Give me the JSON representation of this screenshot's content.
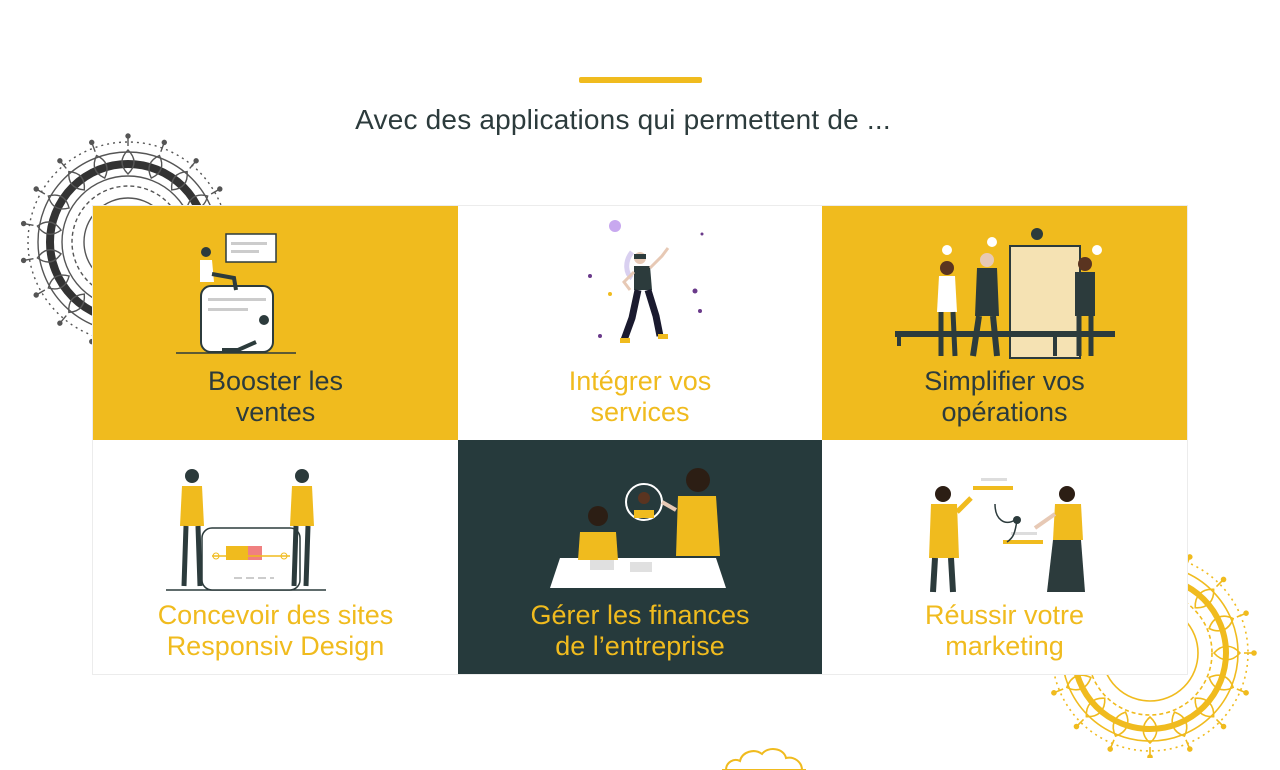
{
  "section": {
    "title": "Avec des applications qui permettent de ..."
  },
  "colors": {
    "accent": "#f0bb1e",
    "dark": "#263a3c",
    "text": "#2c3b3c",
    "white": "#ffffff"
  },
  "cards": [
    {
      "id": "booster",
      "line1": "Booster les",
      "line2": "ventes",
      "theme": "yellow",
      "illustration": "sales-illustration"
    },
    {
      "id": "integrer",
      "line1": "Intégrer vos",
      "line2": "services",
      "theme": "white",
      "illustration": "vr-dancer-illustration"
    },
    {
      "id": "simplifier",
      "line1": "Simplifier vos",
      "line2": "opérations",
      "theme": "yellow",
      "illustration": "queue-illustration"
    },
    {
      "id": "concevoir",
      "line1": "Concevoir des sites",
      "line2": "Responsiv Design",
      "theme": "white",
      "illustration": "web-design-illustration"
    },
    {
      "id": "gerer",
      "line1": "Gérer les finances",
      "line2": "de l’entreprise",
      "theme": "dark",
      "illustration": "meeting-illustration"
    },
    {
      "id": "reussir",
      "line1": "Réussir votre",
      "line2": "marketing",
      "theme": "white",
      "illustration": "marketing-illustration"
    }
  ]
}
